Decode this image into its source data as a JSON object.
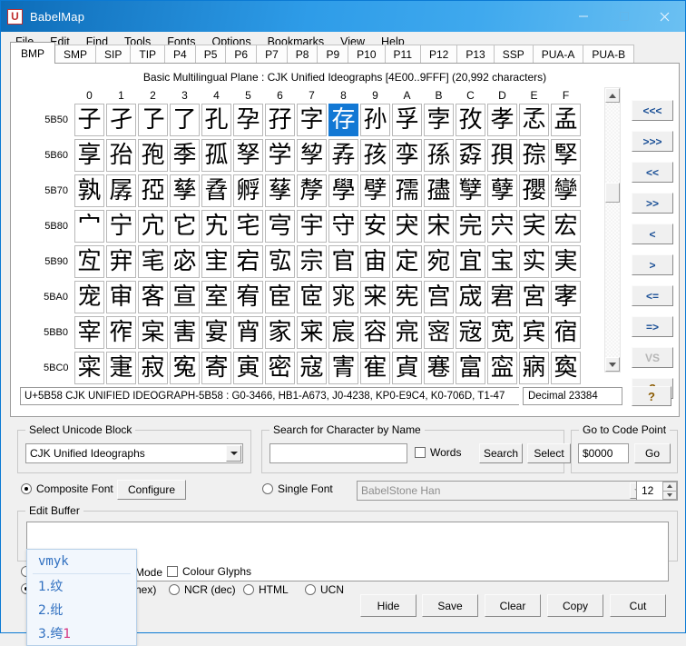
{
  "window": {
    "title": "BabelMap",
    "app_icon_letter": "U",
    "controls": {
      "minimize": "minimize-icon",
      "maximize": "maximize-icon",
      "close": "close-icon"
    },
    "accent": "#2e9ce8"
  },
  "menubar": {
    "items": [
      "File",
      "Edit",
      "Find",
      "Tools",
      "Fonts",
      "Options",
      "Bookmarks",
      "View",
      "Help"
    ]
  },
  "tabs": {
    "active": "BMP",
    "items": [
      "BMP",
      "SMP",
      "SIP",
      "TIP",
      "P4",
      "P5",
      "P6",
      "P7",
      "P8",
      "P9",
      "P10",
      "P11",
      "P12",
      "P13",
      "SSP",
      "PUA-A",
      "PUA-B"
    ]
  },
  "plane": {
    "caption": "Basic Multilingual Plane : CJK Unified Ideographs [4E00..9FFF] (20,992 characters)"
  },
  "grid": {
    "column_headers": [
      "0",
      "1",
      "2",
      "3",
      "4",
      "5",
      "6",
      "7",
      "8",
      "9",
      "A",
      "B",
      "C",
      "D",
      "E",
      "F"
    ],
    "selected_row": 0,
    "selected_col": 8,
    "selection_color": "#1278d4",
    "rows": [
      {
        "label": "5B50",
        "chars": [
          "子",
          "孑",
          "孒",
          "了",
          "孔",
          "孕",
          "孖",
          "字",
          "存",
          "孙",
          "孚",
          "孛",
          "孜",
          "孝",
          "孞",
          "孟"
        ]
      },
      {
        "label": "5B60",
        "chars": [
          "享",
          "孡",
          "孢",
          "季",
          "孤",
          "孥",
          "学",
          "孧",
          "孨",
          "孩",
          "孪",
          "孫",
          "孬",
          "孭",
          "孮",
          "孯"
        ]
      },
      {
        "label": "5B70",
        "chars": [
          "孰",
          "孱",
          "孲",
          "孳",
          "孴",
          "孵",
          "孶",
          "孷",
          "學",
          "孹",
          "孺",
          "孻",
          "孼",
          "孽",
          "孾",
          "孿"
        ]
      },
      {
        "label": "5B80",
        "chars": [
          "宀",
          "宁",
          "宂",
          "它",
          "宄",
          "宅",
          "宆",
          "宇",
          "守",
          "安",
          "宊",
          "宋",
          "完",
          "宍",
          "宎",
          "宏"
        ]
      },
      {
        "label": "5B90",
        "chars": [
          "宐",
          "宑",
          "宒",
          "宓",
          "宔",
          "宕",
          "宖",
          "宗",
          "官",
          "宙",
          "定",
          "宛",
          "宜",
          "宝",
          "实",
          "実"
        ]
      },
      {
        "label": "5BA0",
        "chars": [
          "宠",
          "审",
          "客",
          "宣",
          "室",
          "宥",
          "宦",
          "宧",
          "宨",
          "宩",
          "宪",
          "宫",
          "宬",
          "宭",
          "宮",
          "宯"
        ]
      },
      {
        "label": "5BB0",
        "chars": [
          "宰",
          "宱",
          "宲",
          "害",
          "宴",
          "宵",
          "家",
          "宷",
          "宸",
          "容",
          "宺",
          "宻",
          "宼",
          "宽",
          "宾",
          "宿"
        ]
      },
      {
        "label": "5BC0",
        "chars": [
          "寀",
          "寁",
          "寂",
          "寃",
          "寄",
          "寅",
          "密",
          "寇",
          "寈",
          "寉",
          "寊",
          "寋",
          "富",
          "寍",
          "寎",
          "寏"
        ]
      }
    ]
  },
  "nav_buttons": [
    {
      "label": "<<<",
      "name": "first-block-button",
      "enabled": true
    },
    {
      "label": ">>>",
      "name": "last-block-button",
      "enabled": true
    },
    {
      "label": "<<",
      "name": "prev-block-button",
      "enabled": true
    },
    {
      "label": ">>",
      "name": "next-block-button",
      "enabled": true
    },
    {
      "label": "<",
      "name": "prev-page-button",
      "enabled": true
    },
    {
      "label": ">",
      "name": "next-page-button",
      "enabled": true
    },
    {
      "label": "<=",
      "name": "prev-char-button",
      "enabled": true
    },
    {
      "label": "=>",
      "name": "next-char-button",
      "enabled": true
    },
    {
      "label": "VS",
      "name": "variation-selector-button",
      "enabled": false
    },
    {
      "label": "?",
      "name": "help-nav-button",
      "enabled": true
    }
  ],
  "status": {
    "info": "U+5B58 CJK UNIFIED IDEOGRAPH-5B58 : G0-3466, HB1-A673, J0-4238, KP0-E9C4, K0-706D, T1-47",
    "decimal": "Decimal 23384",
    "help_button": "?"
  },
  "unicode_block": {
    "legend": "Select Unicode Block",
    "value": "CJK Unified Ideographs"
  },
  "search": {
    "legend": "Search for Character by Name",
    "value": "",
    "placeholder": "",
    "words_label": "Words",
    "words_checked": false,
    "search_button": "Search",
    "select_button": "Select"
  },
  "goto": {
    "legend": "Go to Code Point",
    "value": "$0000",
    "go_button": "Go"
  },
  "font_mode": {
    "composite_label": "Composite Font",
    "composite_selected": true,
    "configure_button": "Configure",
    "single_label": "Single Font",
    "single_selected": false,
    "single_font_value": "BabelStone Han",
    "size_value": "12"
  },
  "edit_buffer": {
    "legend": "Edit Buffer",
    "text": ""
  },
  "bottom_options": {
    "mode_label_partial": "Mode",
    "hex_label_partial": "hex)",
    "colour_glyphs_label": "Colour Glyphs",
    "colour_glyphs_checked": false,
    "radios": [
      {
        "label": "NCR (dec)",
        "selected": false
      },
      {
        "label": "HTML",
        "selected": false
      },
      {
        "label": "UCN",
        "selected": false
      }
    ]
  },
  "action_buttons": [
    "Hide",
    "Save",
    "Clear",
    "Copy",
    "Cut"
  ],
  "ime_popup": {
    "composition": "vmyk",
    "candidates": [
      {
        "index": "1.",
        "text": "纹",
        "marker": ""
      },
      {
        "index": "2.",
        "text": "纰",
        "marker": ""
      },
      {
        "index": "3.",
        "text": "绔",
        "marker": "1"
      }
    ]
  }
}
